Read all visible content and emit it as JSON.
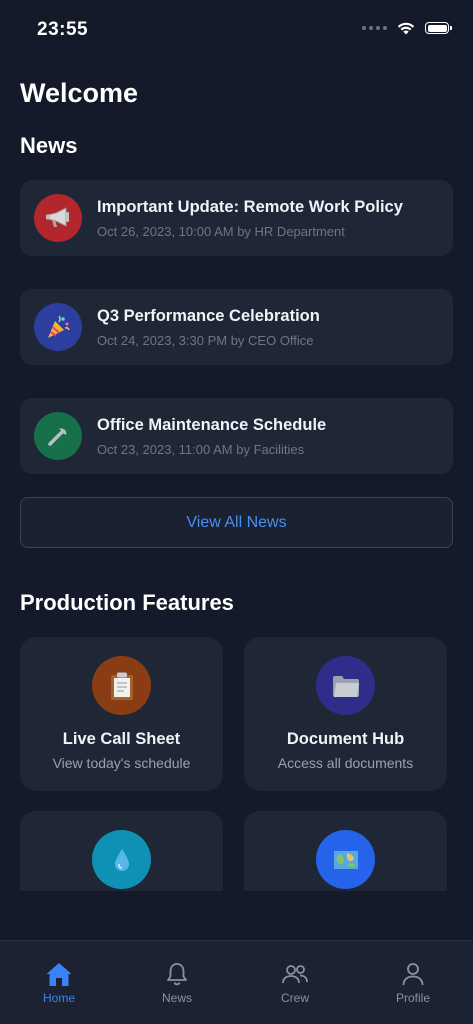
{
  "status_bar": {
    "time": "23:55"
  },
  "header": {
    "welcome": "Welcome"
  },
  "news": {
    "title": "News",
    "items": [
      {
        "title": "Important Update: Remote Work Policy",
        "meta": "Oct 26, 2023, 10:00 AM by HR Department",
        "icon": "megaphone-icon",
        "icon_bg": "#b3262b"
      },
      {
        "title": "Q3 Performance Celebration",
        "meta": "Oct 24, 2023, 3:30 PM by CEO Office",
        "icon": "party-popper-icon",
        "icon_bg": "#2c3e9e"
      },
      {
        "title": "Office Maintenance Schedule",
        "meta": "Oct 23, 2023, 11:00 AM by Facilities",
        "icon": "wrench-icon",
        "icon_bg": "#17704a"
      }
    ],
    "view_all_label": "View All News"
  },
  "features": {
    "title": "Production Features",
    "items": [
      {
        "title": "Live Call Sheet",
        "subtitle": "View today's schedule",
        "icon": "clipboard-icon",
        "icon_bg": "#8a3d14"
      },
      {
        "title": "Document Hub",
        "subtitle": "Access all documents",
        "icon": "folder-icon",
        "icon_bg": "#2e2e8a"
      },
      {
        "icon": "droplet-icon",
        "icon_bg": "#0e91b5"
      },
      {
        "icon": "map-icon",
        "icon_bg": "#2563eb"
      }
    ]
  },
  "tab_bar": {
    "tabs": [
      {
        "label": "Home",
        "icon": "home-icon",
        "active": true
      },
      {
        "label": "News",
        "icon": "bell-icon",
        "active": false
      },
      {
        "label": "Crew",
        "icon": "users-icon",
        "active": false
      },
      {
        "label": "Profile",
        "icon": "user-icon",
        "active": false
      }
    ],
    "active_color": "#3b82f6",
    "inactive_color": "#8a92a0"
  }
}
